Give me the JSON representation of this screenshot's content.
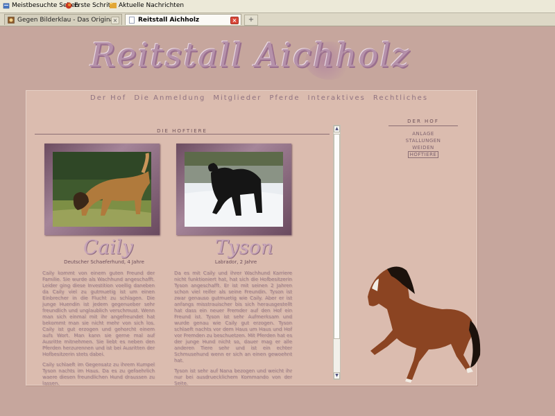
{
  "browser": {
    "bookmarks": [
      "Meistbesuchte Seiten",
      "Erste Schritte",
      "Aktuelle Nachrichten"
    ],
    "tabs": [
      {
        "label": "Gegen Bilderklau - Das Original | Bewer..."
      },
      {
        "label": "Reitstall Aichholz"
      }
    ],
    "new_tab": "+",
    "close_glyph": "×"
  },
  "site": {
    "logo": "Reitstall Aichholz",
    "nav": [
      "Der Hof",
      "Die Anmeldung",
      "Mitglieder",
      "Pferde",
      "Interaktives",
      "Rechtliches"
    ]
  },
  "main": {
    "section_title": "DIE HOFTIERE",
    "animals": [
      {
        "name": "Caily",
        "breed": "Deutscher Schaeferhund, 4 Jahre",
        "bio": [
          "Caily kommt von einem guten Freund der Familie. Sie wurde als Wachhund angeschafft. Leider ging diese Investition voellig daneben da Caily viel zu gutmuetig ist um einen Einbrecher in die Flucht zu schlagen. Die junge Huendin ist jedem gegenueber sehr freundlich und unglaublich verschmust. Wenn man sich einmal mit ihr angefreundet hat bekommt man sie nicht mehr von sich los. Caily ist gut erzogen und gehorcht einem aufs Wort. Man kann sie gerne mal auf Ausritte mitnehmen. Sie liebt es neben den Pferden herzurennen und ist bei Ausritten der Hofbesitzerin stets dabei.",
          "Caily schlaeft im Gegensatz zu ihrem Kumpel Tyson nachts im Haus. Da es zu gefaehrlich waere diesen freundlichen Hund draussen zu lassen."
        ]
      },
      {
        "name": "Tyson",
        "breed": "Labrador, 2 Jahre",
        "bio": [
          "Da es mit Caily und ihrer Wachhund Karriere nicht funktioniert hat, hat sich die Hofbesitzerin Tyson angeschafft. Er ist mit seinen 2 Jahren schon viel reifer als seine Freundin. Tyson ist zwar genauso gutmuetig wie Caily. Aber er ist anfangs misstrauischer bis sich herausgestellt hat dass ein neuer Fremder auf den Hof ein Freund ist. Tyson ist sehr Aufmerksam und wurde genau wie Caily gut erzogen. Tyson schlaeft nachts vor dem Haus um Haus und Hof vor Fremden zu beschuetzen. Mit Pferden hat es der junge Hund nicht so, dauer mag er alle anderen Tiere sehr und ist ein echter Schmusehund wenn er sich an einen gewoehnt hat.",
          "Tyson ist sehr auf Nana bezogen und weicht ihr nur bei ausdruecklichem Kommando von der Seite."
        ]
      }
    ]
  },
  "sidebar": {
    "title": "DER HOF",
    "items": [
      "ANLAGE",
      "STALLUNGEN",
      "WEIDEN",
      "HOFTIERE"
    ],
    "active": "HOFTIERE"
  },
  "colors": {
    "page_bg": "#c6a69d",
    "panel_bg": "#dbbcaf",
    "logo": "#b591aa",
    "nav_text": "#8f7280",
    "body_text": "#9b7d8a"
  }
}
